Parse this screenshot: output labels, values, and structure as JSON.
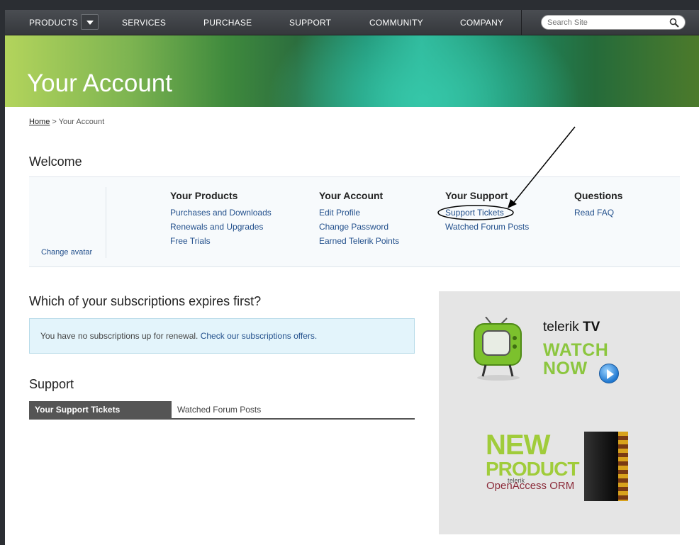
{
  "nav": {
    "items": [
      "PRODUCTS",
      "SERVICES",
      "PURCHASE",
      "SUPPORT",
      "COMMUNITY",
      "COMPANY"
    ],
    "search_placeholder": "Search Site"
  },
  "banner": {
    "title": "Your Account"
  },
  "breadcrumb": {
    "home": "Home",
    "separator": ">",
    "current": "Your Account"
  },
  "welcome": {
    "heading": "Welcome",
    "change_avatar": "Change avatar",
    "columns": [
      {
        "title": "Your Products",
        "links": [
          "Purchases and Downloads",
          "Renewals and Upgrades",
          "Free Trials"
        ]
      },
      {
        "title": "Your Account",
        "links": [
          "Edit Profile",
          "Change Password",
          "Earned Telerik Points"
        ]
      },
      {
        "title": "Your Support",
        "links": [
          "Support Tickets",
          "Watched Forum Posts"
        ]
      },
      {
        "title": "Questions",
        "links": [
          "Read FAQ"
        ]
      }
    ]
  },
  "subscriptions": {
    "heading": "Which of your subscriptions expires first?",
    "notice_text": "You have no subscriptions up for renewal.",
    "notice_link": "Check our subscriptions offers."
  },
  "support": {
    "heading": "Support",
    "tabs": [
      "Your Support Tickets",
      "Watched Forum Posts"
    ]
  },
  "promo": {
    "tv_brand_prefix": "telerik",
    "tv_brand_suffix": "TV",
    "watch_line1": "WATCH",
    "watch_line2": "NOW",
    "new_line1": "NEW",
    "new_line2": "PRODUCT",
    "oa_small": "telerik",
    "oa_name": "OpenAccess ORM"
  },
  "colors": {
    "link": "#23508c",
    "nav_bg": "#3f4247",
    "accent_green": "#8cc63f"
  }
}
